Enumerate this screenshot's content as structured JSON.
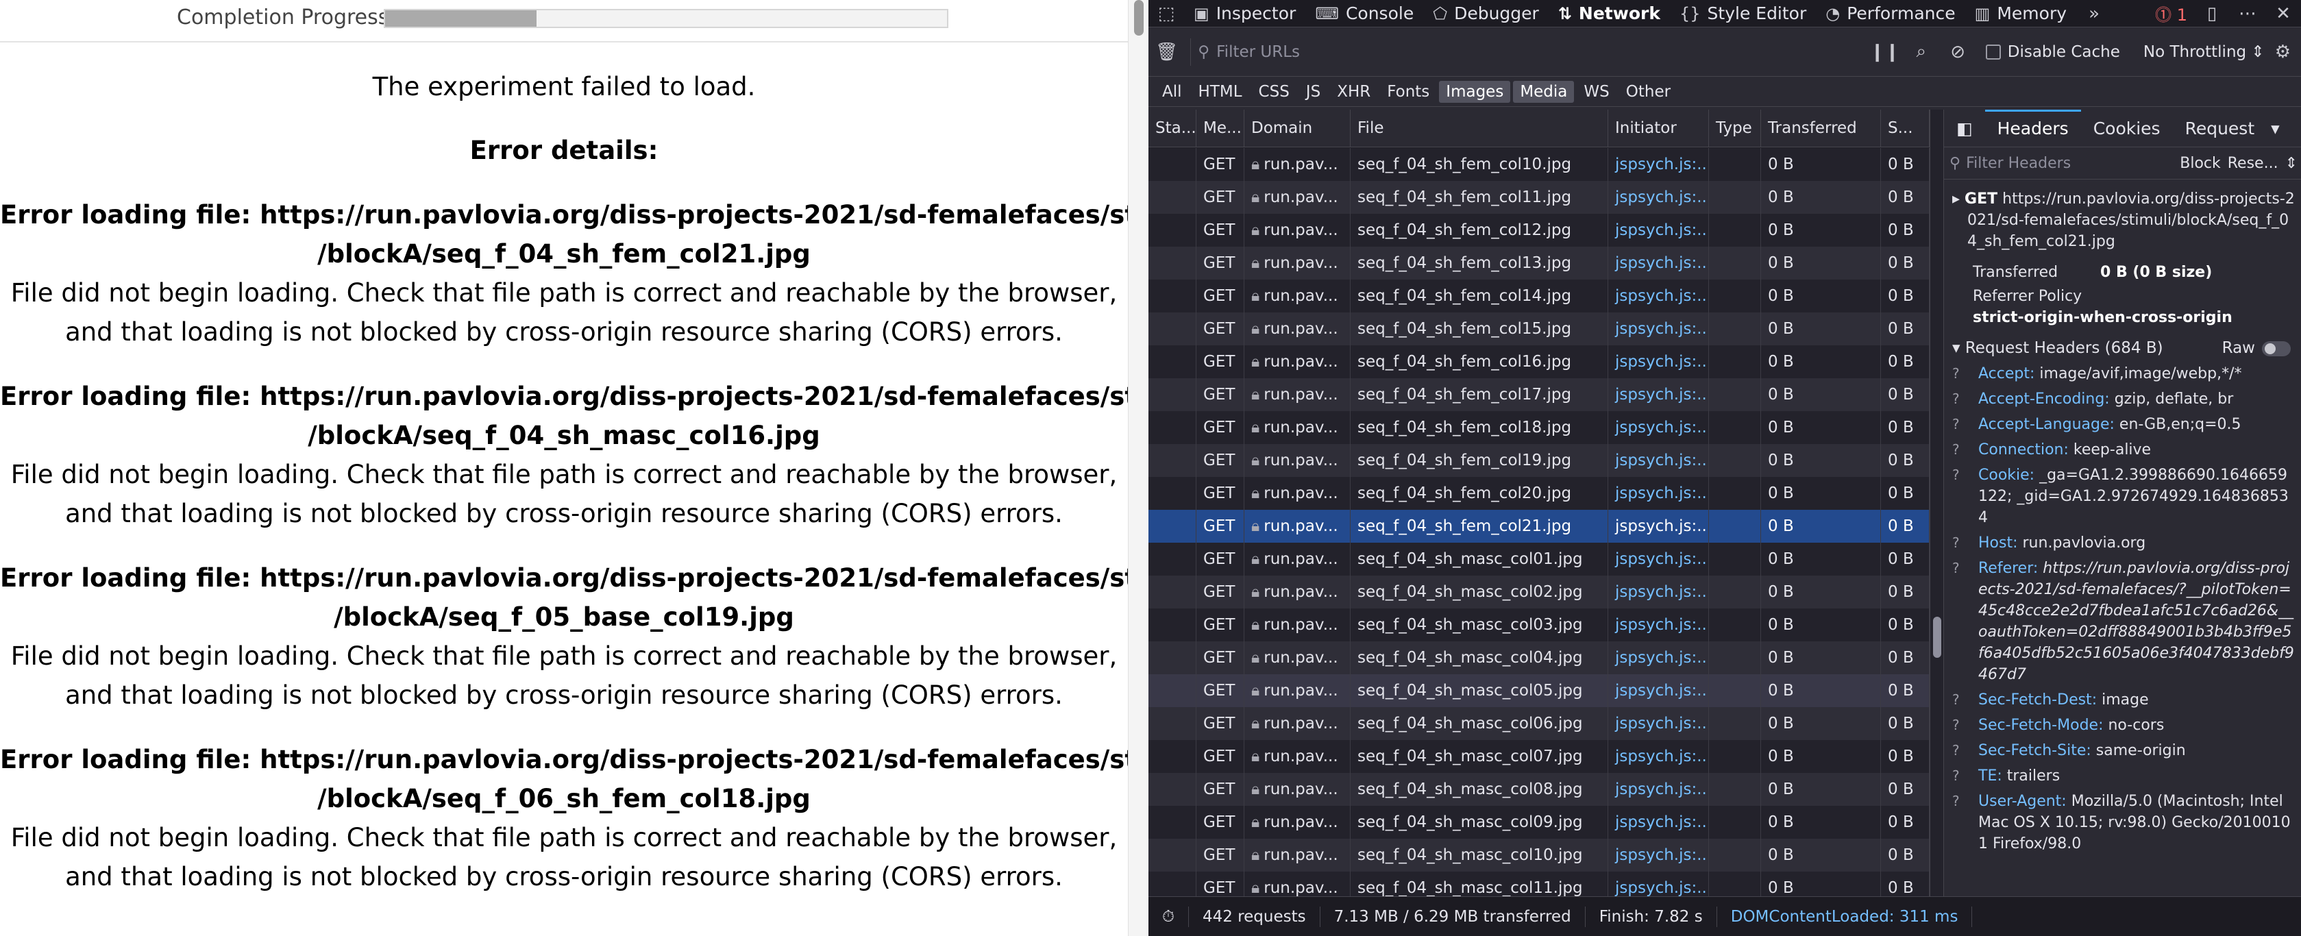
{
  "experiment": {
    "progress_label": "Completion Progress",
    "progress_fraction": 0.27,
    "load_message": "The experiment failed to load.",
    "details_title": "Error details:",
    "errors": [
      {
        "file_line1": "Error loading file: https://run.pavlovia.org/diss-projects-2021/sd-femalefaces/stimuli",
        "file_line2": "/blockA/seq_f_04_sh_fem_col21.jpg",
        "desc_line1": "File did not begin loading. Check that file path is correct and reachable by the browser,",
        "desc_line2": "and that loading is not blocked by cross-origin resource sharing (CORS) errors."
      },
      {
        "file_line1": "Error loading file: https://run.pavlovia.org/diss-projects-2021/sd-femalefaces/stimuli",
        "file_line2": "/blockA/seq_f_04_sh_masc_col16.jpg",
        "desc_line1": "File did not begin loading. Check that file path is correct and reachable by the browser,",
        "desc_line2": "and that loading is not blocked by cross-origin resource sharing (CORS) errors."
      },
      {
        "file_line1": "Error loading file: https://run.pavlovia.org/diss-projects-2021/sd-femalefaces/stimuli",
        "file_line2": "/blockA/seq_f_05_base_col19.jpg",
        "desc_line1": "File did not begin loading. Check that file path is correct and reachable by the browser,",
        "desc_line2": "and that loading is not blocked by cross-origin resource sharing (CORS) errors."
      },
      {
        "file_line1": "Error loading file: https://run.pavlovia.org/diss-projects-2021/sd-femalefaces/stimuli",
        "file_line2": "/blockA/seq_f_06_sh_fem_col18.jpg",
        "desc_line1": "File did not begin loading. Check that file path is correct and reachable by the browser,",
        "desc_line2": "and that loading is not blocked by cross-origin resource sharing (CORS) errors."
      }
    ]
  },
  "devtools": {
    "tabs": {
      "inspector": "Inspector",
      "console": "Console",
      "debugger": "Debugger",
      "network": "Network",
      "style_editor": "Style Editor",
      "performance": "Performance",
      "memory": "Memory"
    },
    "error_count": "1",
    "filter_placeholder": "Filter URLs",
    "disable_cache": "Disable Cache",
    "throttling": "No Throttling ⇕",
    "type_filters": [
      "All",
      "HTML",
      "CSS",
      "JS",
      "XHR",
      "Fonts",
      "Images",
      "Media",
      "WS",
      "Other"
    ],
    "columns": [
      "Sta...",
      "Me...",
      "Domain",
      "File",
      "Initiator",
      "Type",
      "Transferred",
      "S..."
    ],
    "rows": [
      {
        "method": "GET",
        "domain": "run.pav...",
        "file": "seq_f_04_sh_fem_col10.jpg",
        "initiator": "jspsych.js:...",
        "transferred": "0 B",
        "size": "0 B"
      },
      {
        "method": "GET",
        "domain": "run.pav...",
        "file": "seq_f_04_sh_fem_col11.jpg",
        "initiator": "jspsych.js:...",
        "transferred": "0 B",
        "size": "0 B"
      },
      {
        "method": "GET",
        "domain": "run.pav...",
        "file": "seq_f_04_sh_fem_col12.jpg",
        "initiator": "jspsych.js:...",
        "transferred": "0 B",
        "size": "0 B"
      },
      {
        "method": "GET",
        "domain": "run.pav...",
        "file": "seq_f_04_sh_fem_col13.jpg",
        "initiator": "jspsych.js:...",
        "transferred": "0 B",
        "size": "0 B"
      },
      {
        "method": "GET",
        "domain": "run.pav...",
        "file": "seq_f_04_sh_fem_col14.jpg",
        "initiator": "jspsych.js:...",
        "transferred": "0 B",
        "size": "0 B"
      },
      {
        "method": "GET",
        "domain": "run.pav...",
        "file": "seq_f_04_sh_fem_col15.jpg",
        "initiator": "jspsych.js:...",
        "transferred": "0 B",
        "size": "0 B"
      },
      {
        "method": "GET",
        "domain": "run.pav...",
        "file": "seq_f_04_sh_fem_col16.jpg",
        "initiator": "jspsych.js:...",
        "transferred": "0 B",
        "size": "0 B"
      },
      {
        "method": "GET",
        "domain": "run.pav...",
        "file": "seq_f_04_sh_fem_col17.jpg",
        "initiator": "jspsych.js:...",
        "transferred": "0 B",
        "size": "0 B"
      },
      {
        "method": "GET",
        "domain": "run.pav...",
        "file": "seq_f_04_sh_fem_col18.jpg",
        "initiator": "jspsych.js:...",
        "transferred": "0 B",
        "size": "0 B"
      },
      {
        "method": "GET",
        "domain": "run.pav...",
        "file": "seq_f_04_sh_fem_col19.jpg",
        "initiator": "jspsych.js:...",
        "transferred": "0 B",
        "size": "0 B"
      },
      {
        "method": "GET",
        "domain": "run.pav...",
        "file": "seq_f_04_sh_fem_col20.jpg",
        "initiator": "jspsych.js:...",
        "transferred": "0 B",
        "size": "0 B"
      },
      {
        "method": "GET",
        "domain": "run.pav...",
        "file": "seq_f_04_sh_fem_col21.jpg",
        "initiator": "jspsych.js:...",
        "transferred": "0 B",
        "size": "0 B",
        "selected": true
      },
      {
        "method": "GET",
        "domain": "run.pav...",
        "file": "seq_f_04_sh_masc_col01.jpg",
        "initiator": "jspsych.js:...",
        "transferred": "0 B",
        "size": "0 B"
      },
      {
        "method": "GET",
        "domain": "run.pav...",
        "file": "seq_f_04_sh_masc_col02.jpg",
        "initiator": "jspsych.js:...",
        "transferred": "0 B",
        "size": "0 B"
      },
      {
        "method": "GET",
        "domain": "run.pav...",
        "file": "seq_f_04_sh_masc_col03.jpg",
        "initiator": "jspsych.js:...",
        "transferred": "0 B",
        "size": "0 B"
      },
      {
        "method": "GET",
        "domain": "run.pav...",
        "file": "seq_f_04_sh_masc_col04.jpg",
        "initiator": "jspsych.js:...",
        "transferred": "0 B",
        "size": "0 B"
      },
      {
        "method": "GET",
        "domain": "run.pav...",
        "file": "seq_f_04_sh_masc_col05.jpg",
        "initiator": "jspsych.js:...",
        "transferred": "0 B",
        "size": "0 B",
        "hover": true
      },
      {
        "method": "GET",
        "domain": "run.pav...",
        "file": "seq_f_04_sh_masc_col06.jpg",
        "initiator": "jspsych.js:...",
        "transferred": "0 B",
        "size": "0 B"
      },
      {
        "method": "GET",
        "domain": "run.pav...",
        "file": "seq_f_04_sh_masc_col07.jpg",
        "initiator": "jspsych.js:...",
        "transferred": "0 B",
        "size": "0 B"
      },
      {
        "method": "GET",
        "domain": "run.pav...",
        "file": "seq_f_04_sh_masc_col08.jpg",
        "initiator": "jspsych.js:...",
        "transferred": "0 B",
        "size": "0 B"
      },
      {
        "method": "GET",
        "domain": "run.pav...",
        "file": "seq_f_04_sh_masc_col09.jpg",
        "initiator": "jspsych.js:...",
        "transferred": "0 B",
        "size": "0 B"
      },
      {
        "method": "GET",
        "domain": "run.pav...",
        "file": "seq_f_04_sh_masc_col10.jpg",
        "initiator": "jspsych.js:...",
        "transferred": "0 B",
        "size": "0 B"
      },
      {
        "method": "GET",
        "domain": "run.pav...",
        "file": "seq_f_04_sh_masc_col11.jpg",
        "initiator": "jspsych.js:...",
        "transferred": "0 B",
        "size": "0 B"
      }
    ],
    "side": {
      "tabs": [
        "Headers",
        "Cookies",
        "Request"
      ],
      "filter_placeholder": "Filter Headers",
      "block": "Block",
      "resend": "Rese...",
      "get_method": "GET",
      "get_url": "https://run.pavlovia.org/diss-projects-2021/sd-femalefaces/stimuli/blockA/seq_f_04_sh_fem_col21.jpg",
      "transferred_label": "Transferred",
      "transferred_value": "0 B (0 B size)",
      "referrer_policy_label": "Referrer Policy",
      "referrer_policy_value": "strict-origin-when-cross-origin",
      "request_headers_title": "Request Headers (684 B)",
      "raw_label": "Raw",
      "headers": [
        {
          "name": "Accept:",
          "value": "image/avif,image/webp,*/*"
        },
        {
          "name": "Accept-Encoding:",
          "value": "gzip, deflate, br"
        },
        {
          "name": "Accept-Language:",
          "value": "en-GB,en;q=0.5"
        },
        {
          "name": "Connection:",
          "value": "keep-alive"
        },
        {
          "name": "Cookie:",
          "value": "_ga=GA1.2.399886690.1646659122; _gid=GA1.2.972674929.1648368534"
        },
        {
          "name": "Host:",
          "value": "run.pavlovia.org"
        },
        {
          "name": "Referer:",
          "value": "https://run.pavlovia.org/diss-projects-2021/sd-femalefaces/?__pilotToken=45c48cce2e2d7fbdea1afc51c7c6ad26&__oauthToken=02dff88849001b3b4b3ff9e5f6a405dfb52c51605a06e3f4047833debf9467d7",
          "italic": true
        },
        {
          "name": "Sec-Fetch-Dest:",
          "value": "image"
        },
        {
          "name": "Sec-Fetch-Mode:",
          "value": "no-cors"
        },
        {
          "name": "Sec-Fetch-Site:",
          "value": "same-origin"
        },
        {
          "name": "TE:",
          "value": "trailers"
        },
        {
          "name": "User-Agent:",
          "value": "Mozilla/5.0 (Macintosh; Intel Mac OS X 10.15; rv:98.0) Gecko/20100101 Firefox/98.0"
        }
      ]
    },
    "status": {
      "requests": "442 requests",
      "transferred": "7.13 MB / 6.29 MB transferred",
      "finish": "Finish: 7.82 s",
      "dom_loaded": "DOMContentLoaded: 311 ms"
    }
  }
}
